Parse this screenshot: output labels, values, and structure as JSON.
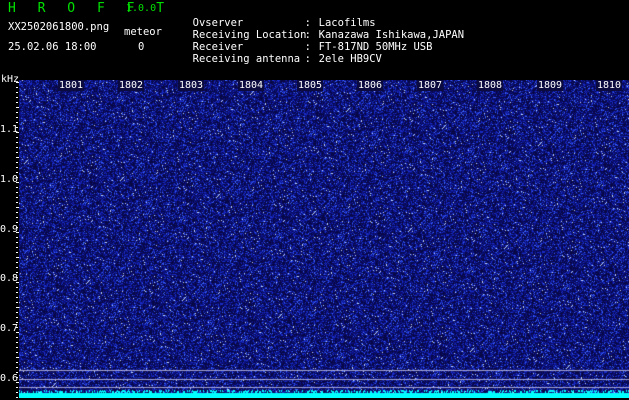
{
  "app": {
    "title": "H R O F F T",
    "version": "1.0.0"
  },
  "file": {
    "name": "XX2502061800.png",
    "datetime": "25.02.06 18:00"
  },
  "meteor": {
    "label": "meteor",
    "count": "0"
  },
  "info": [
    {
      "key": "Ovserver",
      "value": "Lacofilms"
    },
    {
      "key": "Receiving Location",
      "value": "Kanazawa Ishikawa,JAPAN"
    },
    {
      "key": "Receiver",
      "value": "FT-817ND 50MHz USB"
    },
    {
      "key": "Receiving antenna",
      "value": "2ele HB9CV"
    }
  ],
  "info_sep": ":",
  "y_unit": "kHz",
  "y_labels": [
    "1.1",
    "1.0",
    "0.9",
    "0.8",
    "0.7",
    "0.6"
  ],
  "x_labels": [
    "1801",
    "1802",
    "1803",
    "1804",
    "1805",
    "1806",
    "1807",
    "1808",
    "1809",
    "1810"
  ],
  "colors": {
    "title": "#00e000",
    "background": "#000000",
    "noise_floor": "#0a0a60",
    "noise_dots": "#3a5cff",
    "bottom_band": "#00ffff"
  }
}
